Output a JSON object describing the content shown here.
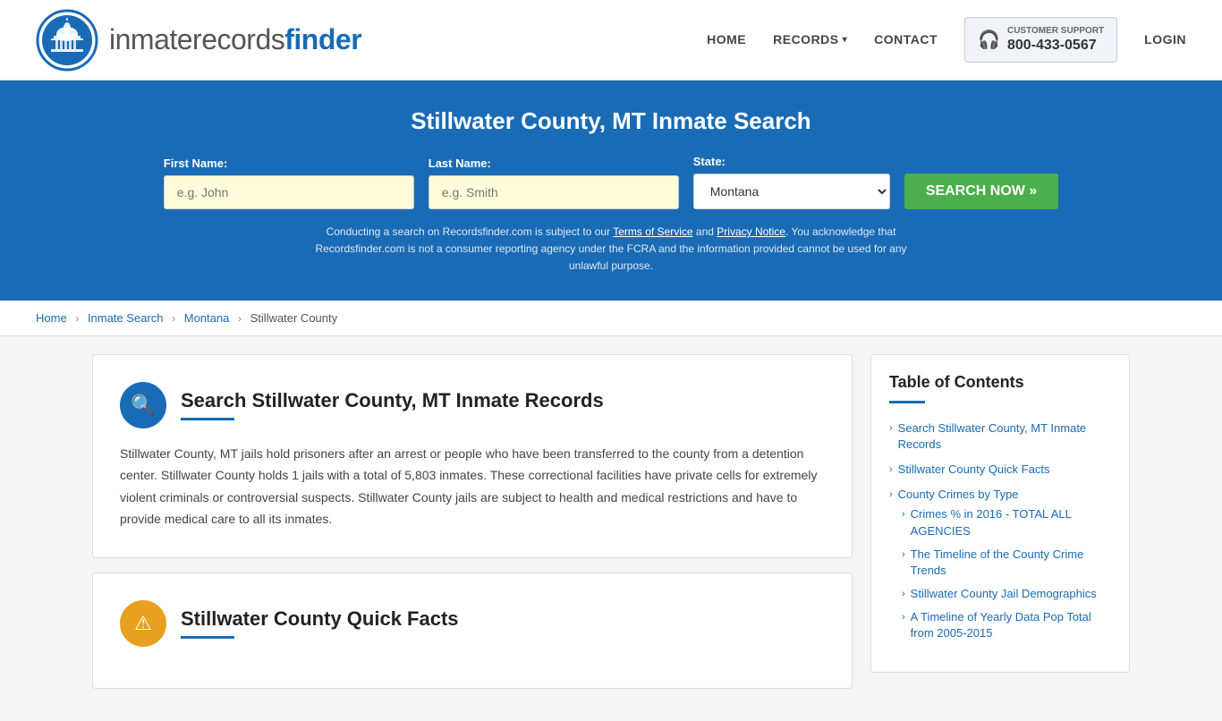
{
  "header": {
    "logo_text_regular": "inmaterecords",
    "logo_text_bold": "finder",
    "nav": {
      "home": "HOME",
      "records": "RECORDS",
      "contact": "CONTACT",
      "login": "LOGIN"
    },
    "support": {
      "label": "CUSTOMER SUPPORT",
      "number": "800-433-0567"
    }
  },
  "hero": {
    "title": "Stillwater County, MT Inmate Search",
    "form": {
      "first_name_label": "First Name:",
      "first_name_placeholder": "e.g. John",
      "last_name_label": "Last Name:",
      "last_name_placeholder": "e.g. Smith",
      "state_label": "State:",
      "state_value": "Montana",
      "search_btn": "SEARCH NOW »"
    },
    "disclaimer": "Conducting a search on Recordsfinder.com is subject to our Terms of Service and Privacy Notice. You acknowledge that Recordsfinder.com is not a consumer reporting agency under the FCRA and the information provided cannot be used for any unlawful purpose."
  },
  "breadcrumb": {
    "home": "Home",
    "inmate_search": "Inmate Search",
    "montana": "Montana",
    "current": "Stillwater County"
  },
  "section1": {
    "title": "Search Stillwater County, MT Inmate Records",
    "body": "Stillwater County, MT jails hold prisoners after an arrest or people who have been transferred to the county from a detention center. Stillwater County holds 1 jails with a total of 5,803 inmates. These correctional facilities have private cells for extremely violent criminals or controversial suspects. Stillwater County jails are subject to health and medical restrictions and have to provide medical care to all its inmates."
  },
  "section2": {
    "title": "Stillwater County Quick Facts"
  },
  "toc": {
    "title": "Table of Contents",
    "items": [
      {
        "label": "Search Stillwater County, MT Inmate Records",
        "sub": false
      },
      {
        "label": "Stillwater County Quick Facts",
        "sub": false
      },
      {
        "label": "County Crimes by Type",
        "sub": false
      },
      {
        "label": "Crimes % in 2016 - TOTAL ALL AGENCIES",
        "sub": true
      },
      {
        "label": "The Timeline of the County Crime Trends",
        "sub": true
      },
      {
        "label": "Stillwater County Jail Demographics",
        "sub": true
      },
      {
        "label": "A Timeline of Yearly Data Pop Total from 2005-2015",
        "sub": true
      }
    ]
  }
}
